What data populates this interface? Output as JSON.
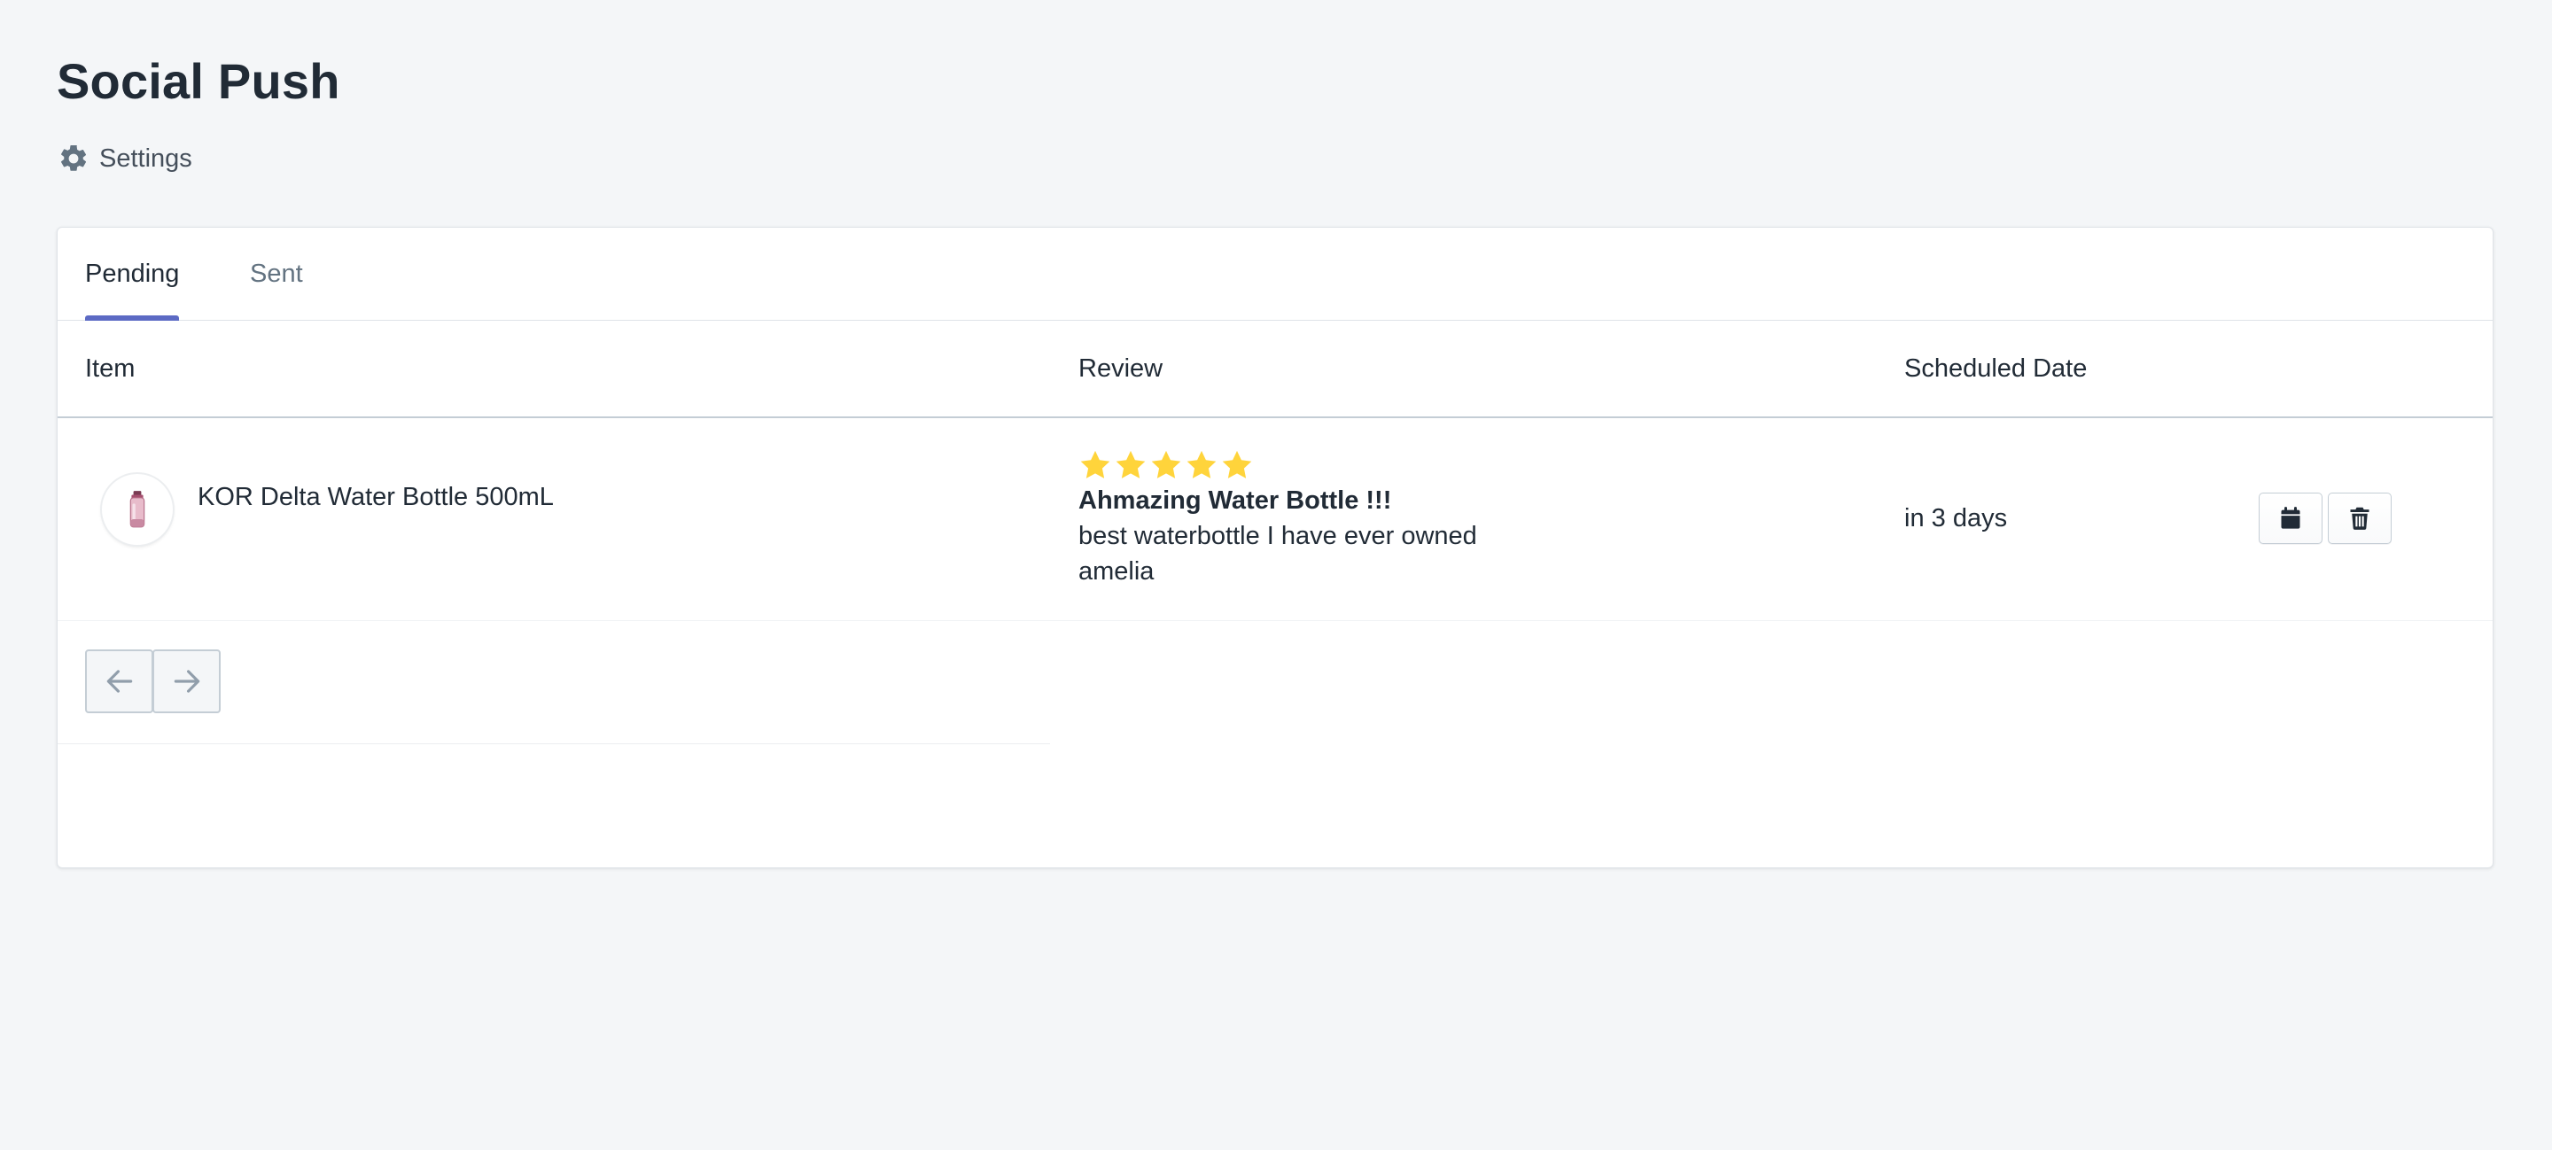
{
  "page": {
    "title": "Social Push",
    "settings_label": "Settings"
  },
  "tabs": [
    {
      "label": "Pending",
      "selected": true
    },
    {
      "label": "Sent",
      "selected": false
    }
  ],
  "table": {
    "columns": [
      "Item",
      "Review",
      "Scheduled Date"
    ],
    "rows": [
      {
        "item_title": "KOR Delta Water Bottle 500mL",
        "rating": 5,
        "review_title": "Ahmazing Water Bottle !!!",
        "review_body": "best waterbottle I have ever owned",
        "review_author": "amelia",
        "scheduled_date": "in 3 days"
      }
    ]
  },
  "icons": {
    "settings": "gear-icon",
    "schedule": "calendar-icon",
    "delete": "trash-icon",
    "prev": "arrow-left-icon",
    "next": "arrow-right-icon",
    "star": "star-icon",
    "thumbnail": "water-bottle-icon"
  },
  "colors": {
    "accent": "#5c6ac4",
    "star": "#ffd43b",
    "text": "#212b36",
    "muted": "#637381",
    "background": "#f4f6f8"
  }
}
